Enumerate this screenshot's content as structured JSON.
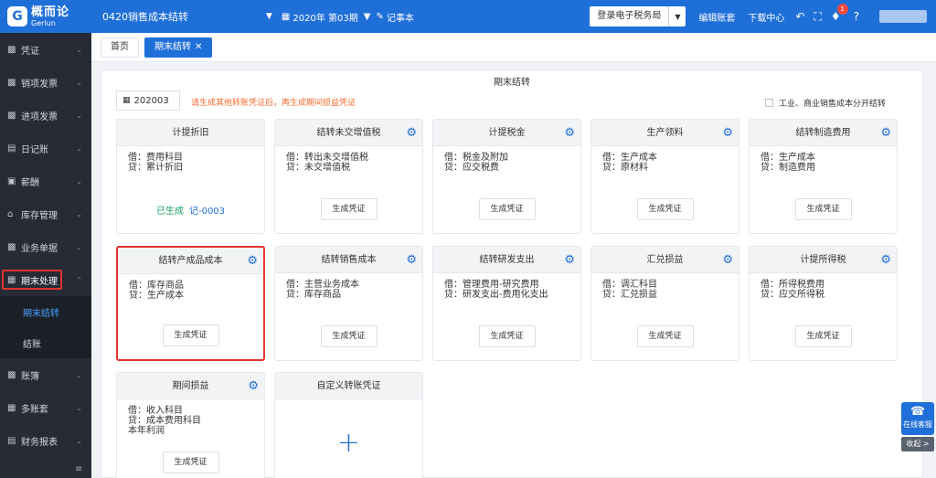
{
  "header": {
    "logo_mark": "G",
    "logo_cn": "概而论",
    "logo_en": "Gerlun",
    "company": "0420销售成本结转",
    "period": "2020年 第03期",
    "journal": "记事本",
    "tax_bureau": "登录电子税务局",
    "edit_books": "编辑账套",
    "download": "下载中心",
    "notify_count": "1"
  },
  "sidebar": {
    "items": [
      {
        "label": "凭证",
        "icon": "voucher-icon"
      },
      {
        "label": "销项发票",
        "icon": "invoice-out-icon"
      },
      {
        "label": "进项发票",
        "icon": "invoice-in-icon"
      },
      {
        "label": "日记账",
        "icon": "journal-icon"
      },
      {
        "label": "薪酬",
        "icon": "salary-icon"
      },
      {
        "label": "库存管理",
        "icon": "inventory-icon"
      },
      {
        "label": "业务单据",
        "icon": "document-icon"
      },
      {
        "label": "期末处理",
        "icon": "period-end-icon"
      },
      {
        "label": "账簿",
        "icon": "ledger-icon"
      },
      {
        "label": "多账套",
        "icon": "multi-books-icon"
      },
      {
        "label": "财务报表",
        "icon": "report-icon"
      }
    ],
    "sub_items": [
      "期末结转",
      "结账"
    ]
  },
  "tabs": [
    {
      "label": "首页"
    },
    {
      "label": "期末结转"
    }
  ],
  "main": {
    "title": "期末结转",
    "period": "202003",
    "hint": "请生成其他转账凭证后，再生成期间损益凭证",
    "separate_option": "工业、商业销售成本分开结转",
    "generate_label": "生成凭证",
    "cards": [
      {
        "title": "计提折旧",
        "lines": [
          "借：费用科目",
          "贷：累计折旧"
        ],
        "status": "已生成",
        "voucher": "记-0003"
      },
      {
        "title": "结转未交增值税",
        "lines": [
          "借：转出未交增值税",
          "贷：未交增值税"
        ]
      },
      {
        "title": "计提税金",
        "lines": [
          "借：税金及附加",
          "贷：应交税费"
        ]
      },
      {
        "title": "生产领料",
        "lines": [
          "借：生产成本",
          "贷：原材料"
        ]
      },
      {
        "title": "结转制造费用",
        "lines": [
          "借：生产成本",
          "贷：制造费用"
        ]
      },
      {
        "title": "结转产成品成本",
        "lines": [
          "借：库存商品",
          "贷：生产成本"
        ]
      },
      {
        "title": "结转销售成本",
        "lines": [
          "借：主营业务成本",
          "贷：库存商品"
        ]
      },
      {
        "title": "结转研发支出",
        "lines": [
          "借：管理费用-研究费用",
          "贷：研发支出-费用化支出"
        ]
      },
      {
        "title": "汇兑损益",
        "lines": [
          "借：调汇科目",
          "贷：汇兑损益"
        ]
      },
      {
        "title": "计提所得税",
        "lines": [
          "借：所得税费用",
          "贷：应交所得税"
        ]
      },
      {
        "title": "期间损益",
        "lines": [
          "借：收入科目",
          "贷：成本费用科目",
          "本年利润"
        ]
      },
      {
        "title": "自定义转账凭证",
        "lines": []
      }
    ]
  },
  "float": {
    "online_service": "在线客服",
    "collapse": "收起 >"
  }
}
